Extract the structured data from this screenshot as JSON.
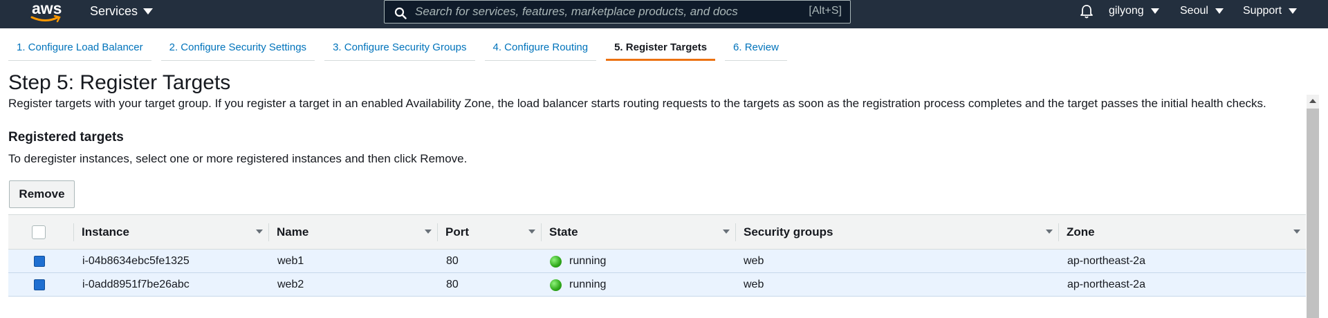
{
  "topbar": {
    "logo_text": "aws",
    "services_label": "Services",
    "search": {
      "placeholder": "Search for services, features, marketplace products, and docs",
      "shortcut": "[Alt+S]"
    },
    "user_label": "gilyong",
    "region_label": "Seoul",
    "support_label": "Support",
    "icons": [
      "aws-logo",
      "search-icon",
      "bell-icon"
    ]
  },
  "tabs": [
    {
      "label": "1. Configure Load Balancer",
      "active": false
    },
    {
      "label": "2. Configure Security Settings",
      "active": false
    },
    {
      "label": "3. Configure Security Groups",
      "active": false
    },
    {
      "label": "4. Configure Routing",
      "active": false
    },
    {
      "label": "5. Register Targets",
      "active": true
    },
    {
      "label": "6. Review",
      "active": false
    }
  ],
  "main": {
    "title": "Step 5: Register Targets",
    "description": "Register targets with your target group. If you register a target in an enabled Availability Zone, the load balancer starts routing requests to the targets as soon as the registration process completes and the target passes the initial health checks.",
    "section_title": "Registered targets",
    "section_description": "To deregister instances, select one or more registered instances and then click Remove.",
    "remove_label": "Remove"
  },
  "table": {
    "columns": [
      "Instance",
      "Name",
      "Port",
      "State",
      "Security groups",
      "Zone"
    ],
    "rows": [
      {
        "selected": true,
        "instance": "i-04b8634ebc5fe1325",
        "name": "web1",
        "port": "80",
        "state": "running",
        "security_groups": "web",
        "zone": "ap-northeast-2a"
      },
      {
        "selected": true,
        "instance": "i-0add8951f7be26abc",
        "name": "web2",
        "port": "80",
        "state": "running",
        "security_groups": "web",
        "zone": "ap-northeast-2a"
      }
    ]
  },
  "colors": {
    "topbar_bg": "#232f3e",
    "link": "#0073bb",
    "active_tab_underline": "#ec7211",
    "selected_row_bg": "#eaf3fe",
    "running_status": "#2fa81a"
  }
}
